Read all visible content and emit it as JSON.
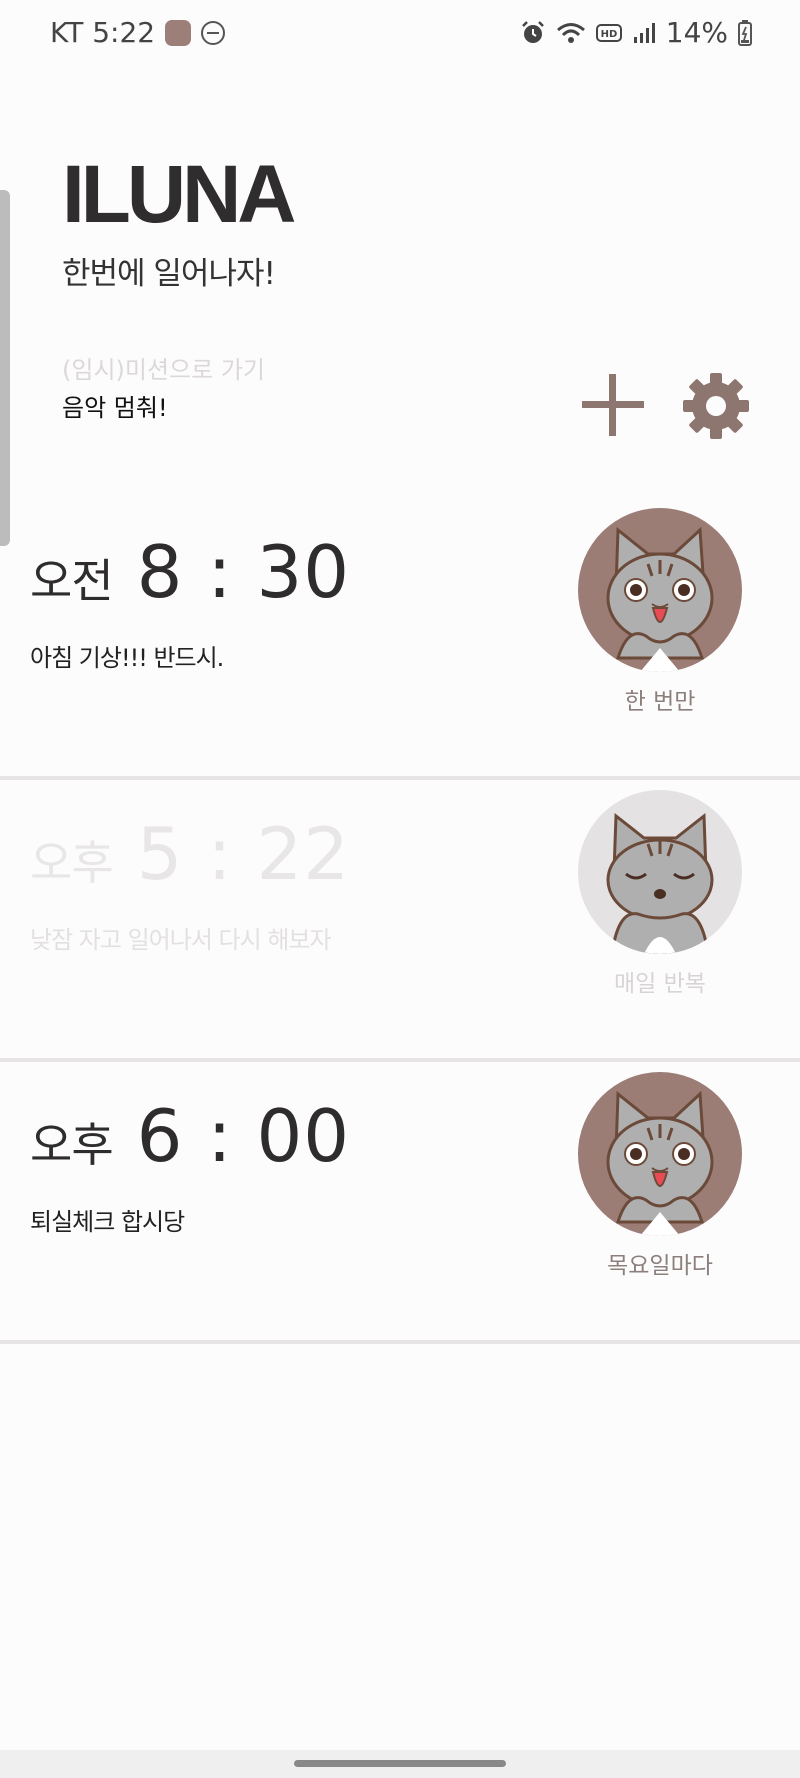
{
  "status_bar": {
    "carrier_time": "KT 5:22",
    "battery": "14%",
    "icons": [
      "app-icon",
      "do-not-disturb-icon",
      "alarm-icon",
      "wifi-icon",
      "hd-icon",
      "signal-icon",
      "battery-icon"
    ]
  },
  "header": {
    "title": "ILUNA",
    "subtitle": "한번에 일어나자!",
    "temp_mission_link": "(임시)미션으로 가기",
    "stop_music": "음악 멈춰!"
  },
  "toolbar": {
    "add_icon": "plus-icon",
    "settings_icon": "gear-icon"
  },
  "alarms": [
    {
      "ampm": "오전",
      "time": "8 : 30",
      "label": "아침 기상!!! 반드시.",
      "repeat": "한 번만",
      "enabled": true,
      "cat": "happy"
    },
    {
      "ampm": "오후",
      "time": "5 : 22",
      "label": "낮잠 자고 일어나서 다시 해보자",
      "repeat": "매일 반복",
      "enabled": false,
      "cat": "sleepy"
    },
    {
      "ampm": "오후",
      "time": "6 : 00",
      "label": "퇴실체크 합시당",
      "repeat": "목요일마다",
      "enabled": true,
      "cat": "happy"
    }
  ],
  "colors": {
    "accent": "#9b7d76",
    "disabled": "#e4e2e3",
    "text": "#2e2c2d"
  }
}
